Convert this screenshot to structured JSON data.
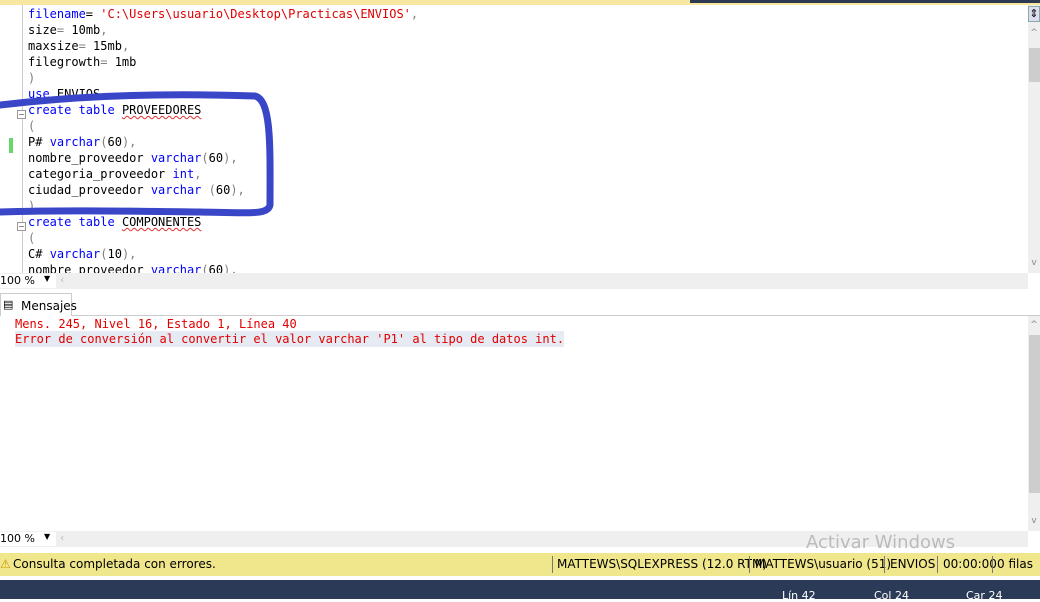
{
  "editor": {
    "lines": [
      "filename= 'C:\\Users\\usuario\\Desktop\\Practicas\\ENVIOS',",
      "size= 10mb,",
      "maxsize= 15mb,",
      "filegrowth= 1mb",
      ")",
      "use ENVIOS",
      "create table PROVEEDORES",
      "(",
      "P# varchar(60),",
      "nombre_proveedor varchar(60),",
      "categoria_proveedor int,",
      "ciudad_proveedor varchar (60),",
      ")",
      "create table COMPONENTES",
      "(",
      "C# varchar(10),",
      "nombre_proveedor varchar(60),"
    ]
  },
  "editor_zoom": "100 %",
  "results_zoom": "100 %",
  "tab": {
    "label": "Mensajes"
  },
  "messages": [
    "Mens. 245, Nivel 16, Estado 1, Línea 40",
    "Error de conversión al convertir el valor varchar 'P1' al tipo de datos int."
  ],
  "status": {
    "text": "Consulta completada con errores.",
    "server": "MATTEWS\\SQLEXPRESS (12.0 RTM)",
    "user": "MATTEWS\\usuario (51)",
    "database": "ENVIOS",
    "time": "00:00:00",
    "rows": "0 filas"
  },
  "watermark": "Activar Windows",
  "cursor": {
    "line": "Lín 42",
    "col": "Col 24",
    "car": "Car 24"
  },
  "colors": {
    "status_bar": "#f0e68c",
    "error": "#e00000",
    "keyword": "#0000ff",
    "annotation": "#3a46c8"
  }
}
